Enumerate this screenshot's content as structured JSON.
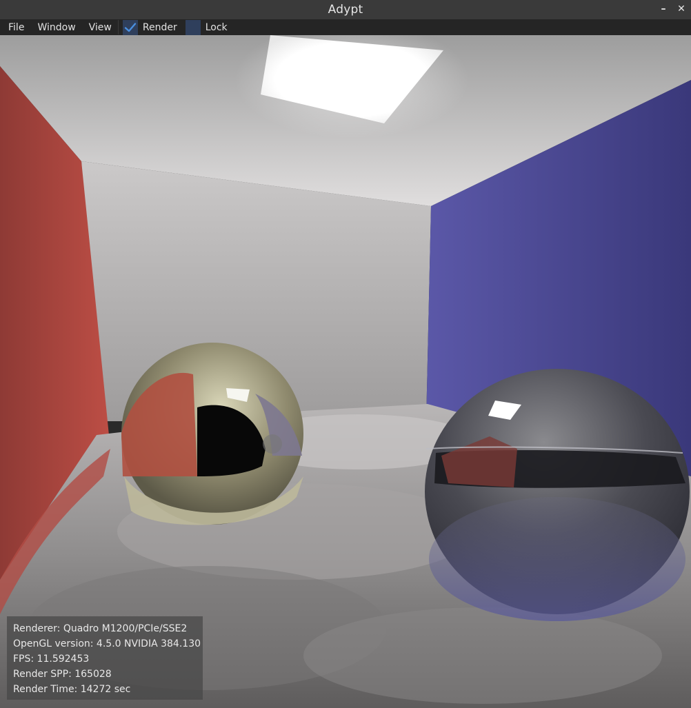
{
  "window": {
    "title": "Adypt",
    "minimize_label": "–",
    "close_label": "✕"
  },
  "menubar": {
    "file_label": "File",
    "window_label": "Window",
    "view_label": "View",
    "render_label": "Render",
    "render_checked": true,
    "lock_label": "Lock",
    "lock_checked": false
  },
  "stats": {
    "renderer": "Renderer: Quadro M1200/PCIe/SSE2",
    "opengl": "OpenGL version: 4.5.0 NVIDIA 384.130",
    "fps": "FPS: 11.592453",
    "spp": "Render SPP: 165028",
    "time": "Render Time: 14272 sec"
  },
  "colors": {
    "accent": "#2f3f5c",
    "check": "#4a8fe0",
    "wall_left": "#b8443e",
    "wall_right": "#4a4690",
    "wall_back": "#cfcdcd"
  },
  "icons": {
    "check": "checkmark-icon"
  }
}
